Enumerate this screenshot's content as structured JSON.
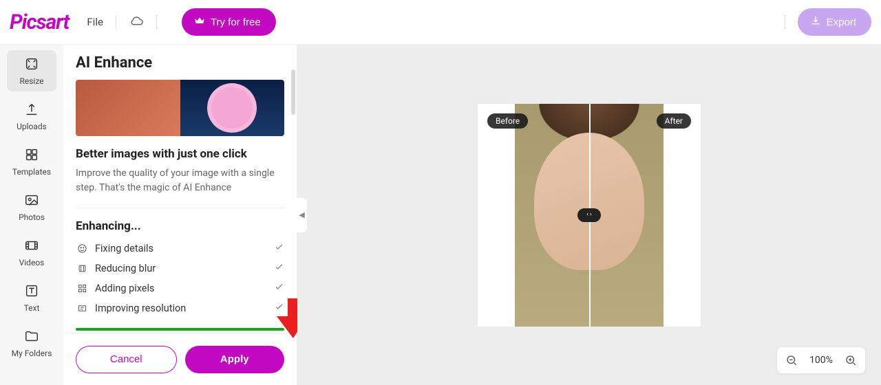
{
  "brand": "Picsart",
  "topbar": {
    "file_label": "File",
    "try_label": "Try for free",
    "export_label": "Export"
  },
  "nav": {
    "items": [
      {
        "label": "Resize",
        "icon": "resize-icon",
        "active": true
      },
      {
        "label": "Uploads",
        "icon": "upload-icon"
      },
      {
        "label": "Templates",
        "icon": "templates-icon"
      },
      {
        "label": "Photos",
        "icon": "photos-icon"
      },
      {
        "label": "Videos",
        "icon": "videos-icon"
      },
      {
        "label": "Text",
        "icon": "text-icon"
      },
      {
        "label": "My Folders",
        "icon": "folders-icon"
      }
    ]
  },
  "panel": {
    "title": "AI Enhance",
    "headline": "Better images with just one click",
    "description": "Improve the quality of your image with a single step. That's the magic of AI Enhance",
    "section": "Enhancing...",
    "items": [
      "Fixing details",
      "Reducing blur",
      "Adding pixels",
      "Improving resolution"
    ],
    "cancel_label": "Cancel",
    "apply_label": "Apply"
  },
  "canvas": {
    "before_label": "Before",
    "after_label": "After"
  },
  "zoom": {
    "value": "100%"
  },
  "colors": {
    "accent": "#c209c1",
    "export": "#c9a6f0",
    "progress": "#1aa61a"
  }
}
